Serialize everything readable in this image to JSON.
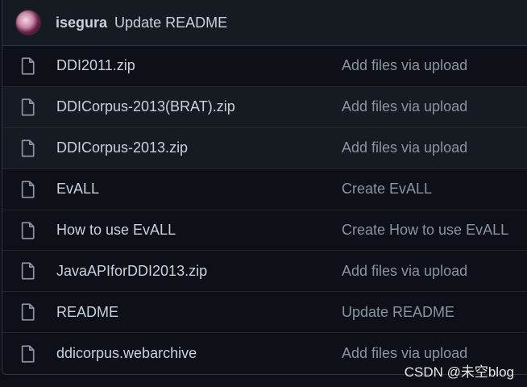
{
  "latest_commit": {
    "author": "isegura",
    "message": "Update README"
  },
  "files": [
    {
      "name": "DDI2011.zip",
      "commit_message": "Add files via upload",
      "icon": "file-icon"
    },
    {
      "name": "DDICorpus-2013(BRAT).zip",
      "commit_message": "Add files via upload",
      "icon": "file-icon"
    },
    {
      "name": "DDICorpus-2013.zip",
      "commit_message": "Add files via upload",
      "icon": "file-icon"
    },
    {
      "name": "EvALL",
      "commit_message": "Create EvALL",
      "icon": "file-icon"
    },
    {
      "name": "How to use EvALL",
      "commit_message": "Create How to use EvALL",
      "icon": "file-icon"
    },
    {
      "name": "JavaAPIforDDI2013.zip",
      "commit_message": "Add files via upload",
      "icon": "file-icon"
    },
    {
      "name": "README",
      "commit_message": "Update README",
      "icon": "file-icon"
    },
    {
      "name": "ddicorpus.webarchive",
      "commit_message": "Add files via upload",
      "icon": "file-icon"
    }
  ],
  "watermark": "CSDN @未空blog",
  "colors": {
    "background": "#0d1117",
    "header_background": "#161b22",
    "border": "#30363d",
    "text": "#c9d1d9",
    "muted_text": "#8b949e"
  }
}
